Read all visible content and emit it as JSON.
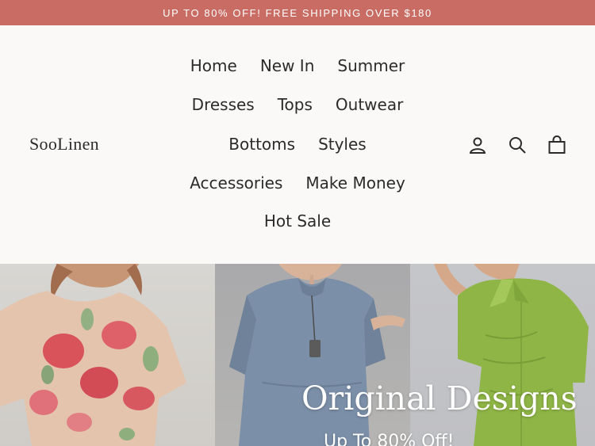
{
  "announcement": "UP TO 80% OFF! FREE SHIPPING OVER $180",
  "brand": "SooLinen",
  "nav": {
    "row1": [
      "Home",
      "New In",
      "Summer"
    ],
    "row2": [
      "Dresses",
      "Tops",
      "Outwear"
    ],
    "row3": [
      "Bottoms",
      "Styles"
    ],
    "row4": [
      "Accessories",
      "Make Money"
    ],
    "row5": [
      "Hot Sale"
    ]
  },
  "icons": [
    "account-icon",
    "search-icon",
    "cart-icon"
  ],
  "hero": {
    "title": "Original Designs",
    "subtitle": "Up To 80% Off!"
  },
  "colors": {
    "announcement_bg": "#c96c63",
    "page_bg": "#fbf9f7",
    "text": "#2b2b2b"
  }
}
